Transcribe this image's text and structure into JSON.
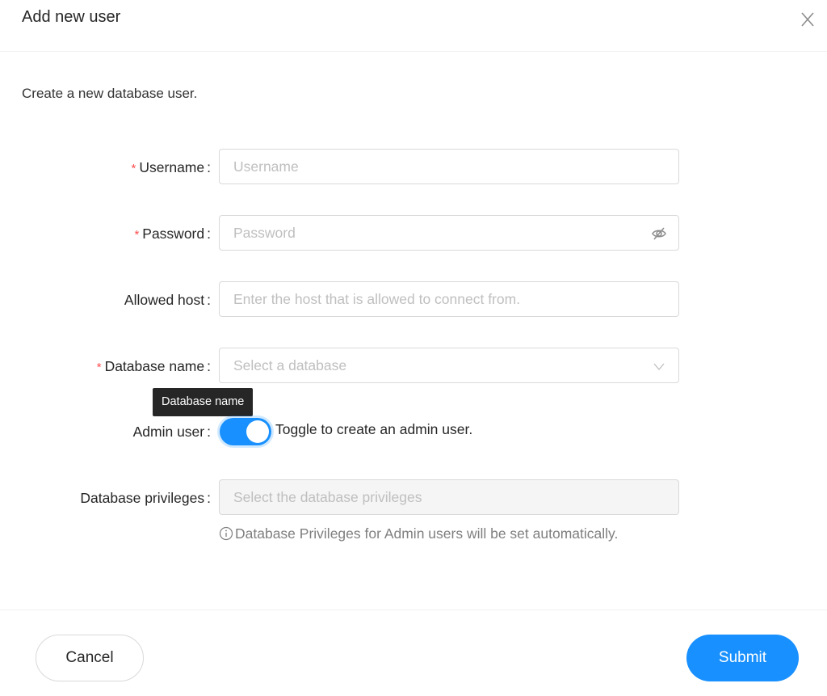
{
  "dialog": {
    "title": "Add new user",
    "description": "Create a new database user.",
    "close_icon": "close-icon"
  },
  "form": {
    "username": {
      "label": "Username",
      "required": true,
      "placeholder": "Username",
      "value": ""
    },
    "password": {
      "label": "Password",
      "required": true,
      "placeholder": "Password",
      "value": "",
      "suffix_icon": "eye-invisible-icon"
    },
    "allowed_host": {
      "label": "Allowed host",
      "required": false,
      "placeholder": "Enter the host that is allowed to connect from.",
      "value": ""
    },
    "database_name": {
      "label": "Database name",
      "required": true,
      "placeholder": "Select a database",
      "suffix_icon": "chevron-down-icon"
    },
    "tooltip": "Database name",
    "admin_user": {
      "label": "Admin user",
      "checked": true,
      "text": "Toggle to create an admin user."
    },
    "database_privileges": {
      "label": "Database privileges",
      "placeholder": "Select the database privileges",
      "disabled": true,
      "help": "Database Privileges for Admin users will be set automatically."
    }
  },
  "footer": {
    "cancel_label": "Cancel",
    "submit_label": "Submit"
  },
  "colors": {
    "primary": "#1890ff",
    "required": "#ff4d4f",
    "tooltip_bg": "#262626"
  },
  "symbols": {
    "required_mark": "*",
    "colon": ":"
  }
}
